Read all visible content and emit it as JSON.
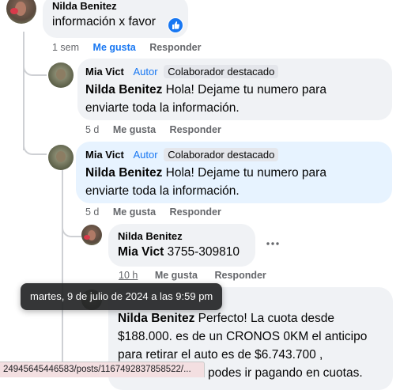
{
  "comments": [
    {
      "author": "Nilda Benitez",
      "text": "información x favor",
      "reaction_icon": "thumbs-up-icon",
      "time": "1 sem",
      "like_label": "Me gusta",
      "reply_label": "Responder"
    },
    {
      "author": "Mia Vict",
      "author_badge": "Autor",
      "badge": "Colaborador destacado",
      "mention": "Nilda Benitez",
      "text_line1": " Hola! Dejame tu numero para",
      "text_line2": "enviarte toda la información.",
      "time": "5 d",
      "like_label": "Me gusta",
      "reply_label": "Responder"
    },
    {
      "author": "Mia Vict",
      "author_badge": "Autor",
      "badge": "Colaborador destacado",
      "mention": "Nilda Benitez",
      "text_line1": " Hola! Dejame tu numero para",
      "text_line2": "enviarte toda la información.",
      "time": "5 d",
      "like_label": "Me gusta",
      "reply_label": "Responder"
    },
    {
      "author": "Nilda Benitez",
      "mention": "Mia Vict",
      "text": " 3755-309810",
      "time": "10 h",
      "like_label": "Me gusta",
      "reply_label": "Responder",
      "more_icon": "more-options-icon"
    },
    {
      "author": "Mia Vict",
      "mention": "Nilda Benitez",
      "text_line1": " Perfecto! La cuota desde",
      "text_line2": "$188.000. es de un CRONOS 0KM el anticipo",
      "text_line3": "para retirar el auto es de $6.743.700 ,",
      "text_line4": "podes ir pagando en cuotas."
    }
  ],
  "tooltip": "martes, 9 de julio de 2024 a las 9:59 pm",
  "status_url": "24945645446583/posts/1167492837858522/...",
  "colors": {
    "accent": "#1877f2",
    "bubble": "#f0f2f5",
    "bubble_highlight": "#e7f3ff",
    "muted": "#65676b"
  }
}
